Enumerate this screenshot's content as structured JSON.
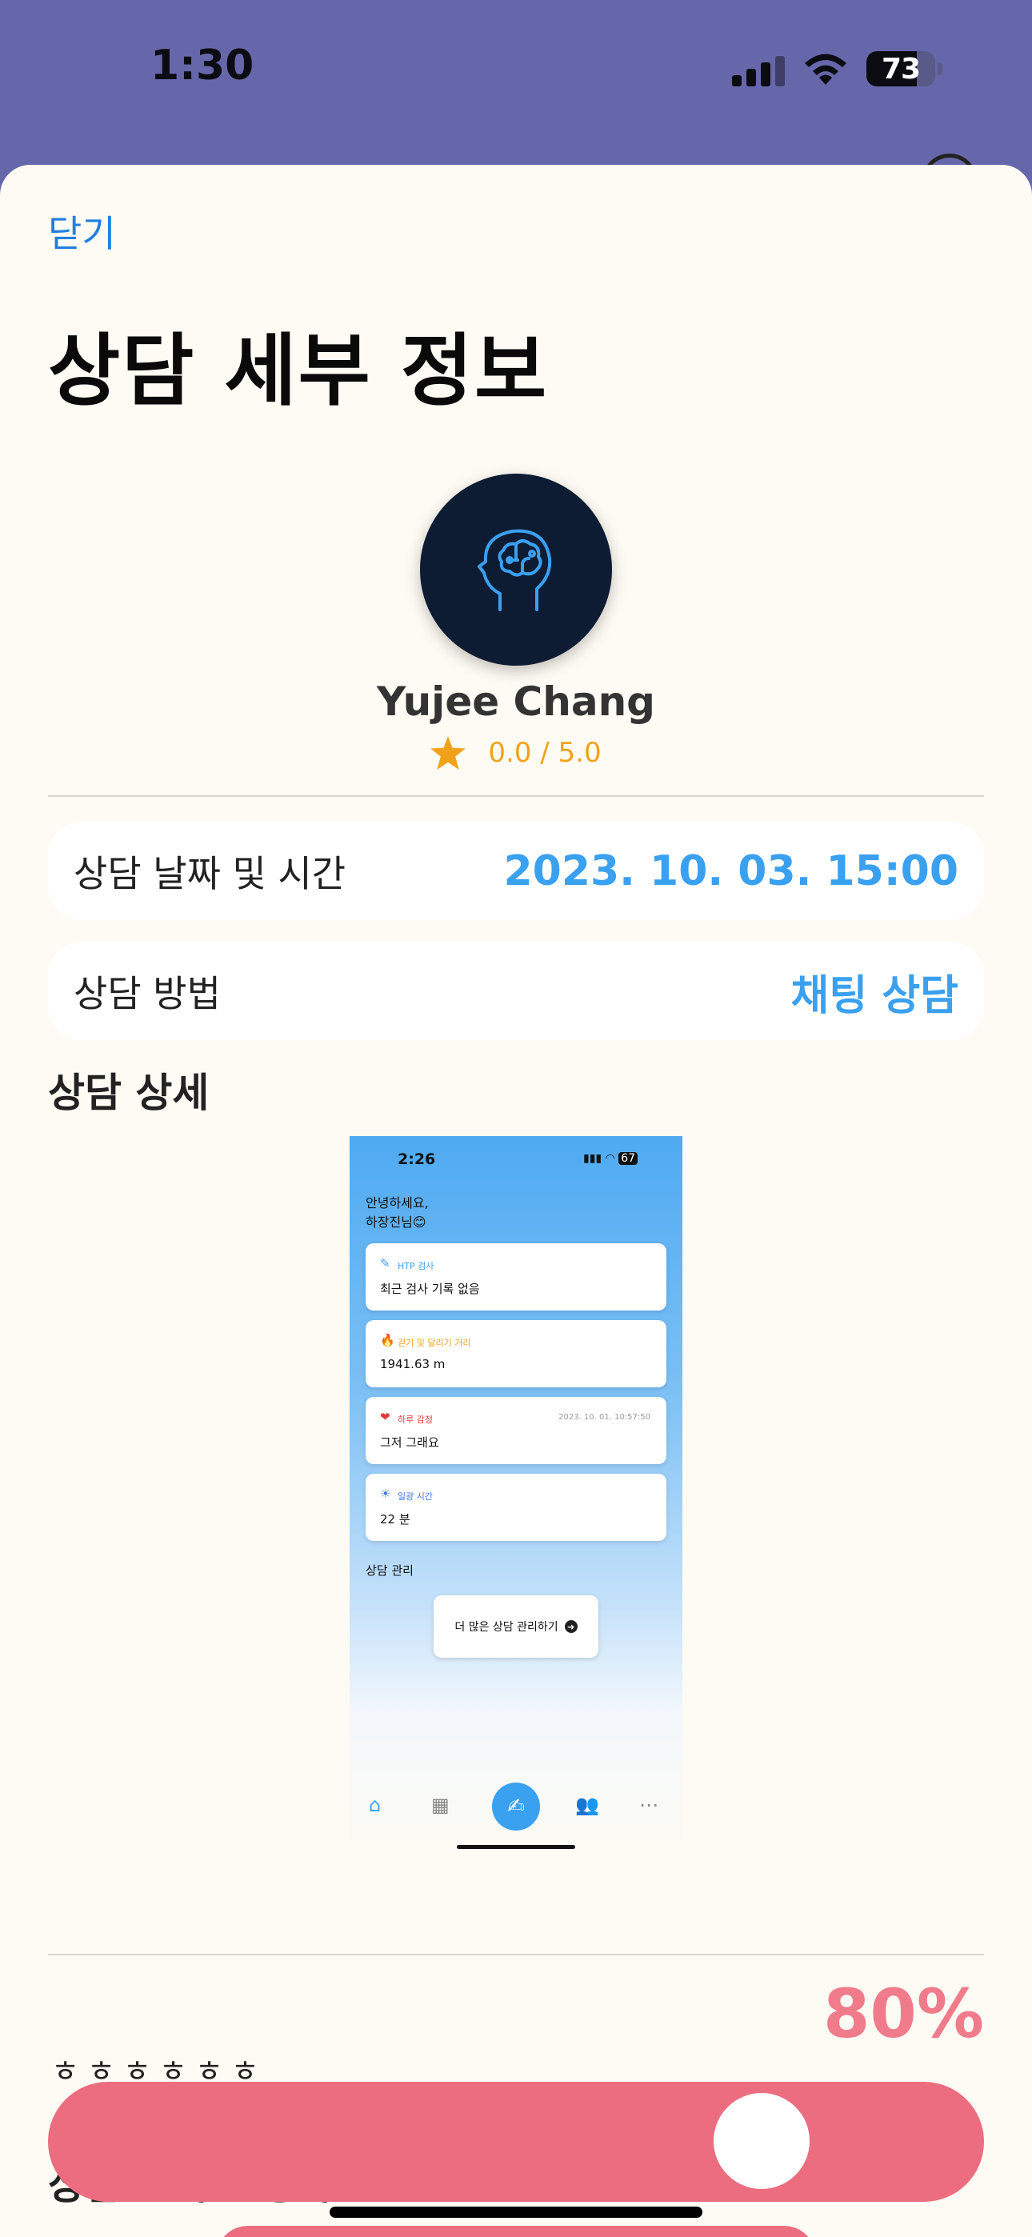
{
  "status_bar": {
    "time": "1:30",
    "battery_level": 73,
    "battery_text": "73"
  },
  "header": {
    "close_label": "닫기",
    "title": "상담 세부 정보"
  },
  "counselor": {
    "avatar_icon": "brain-head-icon",
    "name": "Yujee Chang",
    "rating_text": "0.0 / 5.0"
  },
  "info_rows": [
    {
      "label": "상담 날짜 및 시간",
      "value": "2023. 10. 03. 15:00"
    },
    {
      "label": "상담 방법",
      "value": "채팅 상담"
    }
  ],
  "detail": {
    "section_title": "상담 상세",
    "embedded": {
      "time": "2:26",
      "battery_text": "67",
      "greeting_line1": "안녕하세요,",
      "greeting_line2": "하장진님😊",
      "cards": [
        {
          "icon": "✎",
          "title": "HTP 검사",
          "value": "최근 검사 기록 없음",
          "color": "#3aa0f0"
        },
        {
          "icon": "🔥",
          "title": "걷기 및 달리기 거리",
          "value": "1941.63 m",
          "color": "#f0a21b"
        },
        {
          "icon": "❤",
          "title": "하루 감정",
          "value": "그저 그래요",
          "date": "2023. 10. 01. 10:57:50",
          "color": "#e23b3b"
        },
        {
          "icon": "☀",
          "title": "일광 시간",
          "value": "22 분",
          "color": "#3a7ae0"
        }
      ],
      "section": "상담 관리",
      "more_button": "더 많은 상담 관리하기"
    },
    "memo": "ㅎㅎㅎㅎㅎㅎ"
  },
  "satisfaction": {
    "label": "상담 만족도 평가",
    "value_text": "80%",
    "value": 0.8
  },
  "colors": {
    "accent_blue": "#3aa0f0",
    "rating_orange": "#f0a21b",
    "slider_pink": "#ec6d80",
    "percent_pink": "#f07b8b",
    "header_purple": "#6667ab"
  }
}
